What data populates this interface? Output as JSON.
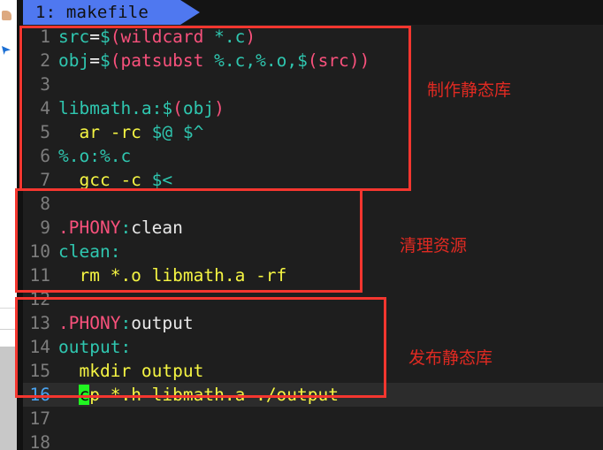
{
  "window": {
    "tab": {
      "label": "1: makefile"
    },
    "background_sliver": {
      "icon_top": "folder-icon",
      "icon_bottom": "pin-icon"
    }
  },
  "editor": {
    "cursor_line": 16,
    "cursor_char": "c",
    "total_visible_lines": 18,
    "lines": [
      {
        "num": "1",
        "text": "src=$(wildcard *.c)"
      },
      {
        "num": "2",
        "text": "obj=$(patsubst %.c,%.o,$(src))"
      },
      {
        "num": "3",
        "text": ""
      },
      {
        "num": "4",
        "text": "libmath.a:$(obj)"
      },
      {
        "num": "5",
        "text": "\tar -rc $@ $^"
      },
      {
        "num": "6",
        "text": "%.o:%.c"
      },
      {
        "num": "7",
        "text": "\tgcc -c $<"
      },
      {
        "num": "8",
        "text": ""
      },
      {
        "num": "9",
        "text": ".PHONY:clean"
      },
      {
        "num": "10",
        "text": "clean:"
      },
      {
        "num": "11",
        "text": "\trm *.o libmath.a -rf"
      },
      {
        "num": "12",
        "text": ""
      },
      {
        "num": "13",
        "text": ".PHONY:output"
      },
      {
        "num": "14",
        "text": "output:"
      },
      {
        "num": "15",
        "text": "\tmkdir output"
      },
      {
        "num": "16",
        "text": "\tcp *.h libmath.a ./output"
      },
      {
        "num": "17",
        "text": ""
      },
      {
        "num": "18",
        "text": ""
      }
    ]
  },
  "annotations": [
    {
      "id": "make-static-lib",
      "label": "制作静态库",
      "covers_lines": "1-7"
    },
    {
      "id": "clean-resources",
      "label": "清理资源",
      "covers_lines": "8-12"
    },
    {
      "id": "publish-static-lib",
      "label": "发布静态库",
      "covers_lines": "12-17"
    }
  ],
  "colors": {
    "annotation_red": "#f4362f",
    "label_red": "#e02a22",
    "tab_blue": "#4f78f0",
    "cursor_green": "#21f521",
    "background": "#1e1e1e",
    "keyword_cyan": "#2fc7b0",
    "function_pink": "#f9517c",
    "command_yellow": "#f5f543"
  }
}
